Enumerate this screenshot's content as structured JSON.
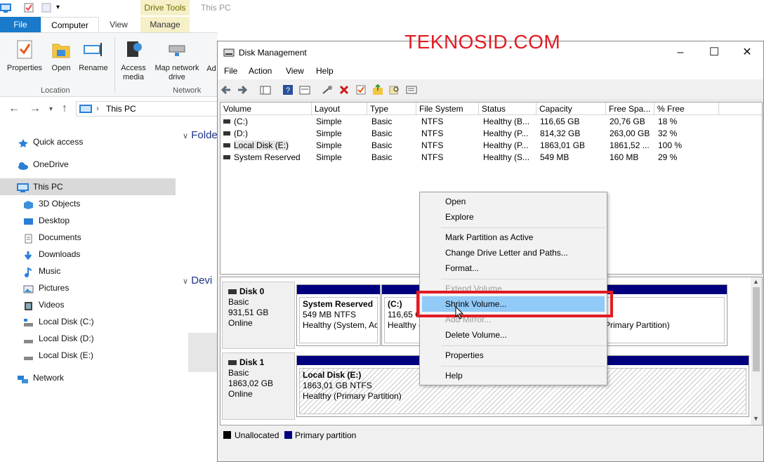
{
  "explorer": {
    "title": "This PC",
    "context_tab": "Drive Tools",
    "tabs": [
      "File",
      "Computer",
      "View",
      "Manage"
    ],
    "ribbon": {
      "buttons": [
        {
          "label": "Properties",
          "icon": "properties-icon"
        },
        {
          "label": "Open",
          "icon": "folder-open-icon"
        },
        {
          "label": "Rename",
          "icon": "rename-icon"
        },
        {
          "label": "Access media",
          "icon": "media-icon"
        },
        {
          "label": "Map network drive",
          "icon": "network-drive-icon"
        },
        {
          "label": "Ad",
          "icon": "add-icon"
        }
      ],
      "groups": [
        "Location",
        "Network"
      ]
    },
    "address": {
      "path": "This PC"
    },
    "nav": [
      {
        "label": "Quick access",
        "icon": "star-icon"
      },
      {
        "label": "OneDrive",
        "icon": "cloud-icon"
      },
      {
        "label": "This PC",
        "icon": "computer-icon",
        "selected": true
      },
      {
        "label": "3D Objects",
        "icon": "cube-icon"
      },
      {
        "label": "Desktop",
        "icon": "desktop-icon"
      },
      {
        "label": "Documents",
        "icon": "document-icon"
      },
      {
        "label": "Downloads",
        "icon": "download-icon"
      },
      {
        "label": "Music",
        "icon": "music-icon"
      },
      {
        "label": "Pictures",
        "icon": "picture-icon"
      },
      {
        "label": "Videos",
        "icon": "video-icon"
      },
      {
        "label": "Local Disk (C:)",
        "icon": "drive-icon"
      },
      {
        "label": "Local Disk (D:)",
        "icon": "drive-icon"
      },
      {
        "label": "Local Disk (E:)",
        "icon": "drive-icon"
      },
      {
        "label": "Network",
        "icon": "network-icon"
      }
    ],
    "groups": [
      "Folde",
      "Devi"
    ]
  },
  "watermark": "TEKNOSID.COM",
  "disk_management": {
    "title": "Disk Management",
    "menu": [
      "File",
      "Action",
      "View",
      "Help"
    ],
    "columns": [
      "Volume",
      "Layout",
      "Type",
      "File System",
      "Status",
      "Capacity",
      "Free Spa...",
      "% Free"
    ],
    "volumes": [
      [
        "(C:)",
        "Simple",
        "Basic",
        "NTFS",
        "Healthy (B...",
        "116,65 GB",
        "20,76 GB",
        "18 %"
      ],
      [
        "(D:)",
        "Simple",
        "Basic",
        "NTFS",
        "Healthy (P...",
        "814,32 GB",
        "263,00 GB",
        "32 %"
      ],
      [
        "Local Disk (E:)",
        "Simple",
        "Basic",
        "NTFS",
        "Healthy (P...",
        "1863,01 GB",
        "1861,52 ...",
        "100 %"
      ],
      [
        "System Reserved",
        "Simple",
        "Basic",
        "NTFS",
        "Healthy (S...",
        "549 MB",
        "160 MB",
        "29 %"
      ]
    ],
    "disks": [
      {
        "name": "Disk 0",
        "type": "Basic",
        "size": "931,51 GB",
        "state": "Online",
        "partitions": [
          {
            "name": "System Reserved",
            "size": "549 MB NTFS",
            "status": "Healthy (System, Ac"
          },
          {
            "name": "(C:)",
            "size": "116,65 G",
            "status": "Healthy ("
          },
          {
            "name": "",
            "size": "",
            "status": "le, Primary Partition)"
          }
        ]
      },
      {
        "name": "Disk 1",
        "type": "Basic",
        "size": "1863,02 GB",
        "state": "Online",
        "partitions": [
          {
            "name": "Local Disk  (E:)",
            "size": "1863,01 GB NTFS",
            "status": "Healthy (Primary Partition)"
          }
        ]
      }
    ],
    "legend": [
      {
        "label": "Unallocated",
        "color": "#000000"
      },
      {
        "label": "Primary partition",
        "color": "#00007f"
      }
    ]
  },
  "context_menu": {
    "items": [
      {
        "label": "Open",
        "enabled": true
      },
      {
        "label": "Explore",
        "enabled": true
      },
      {
        "label": "Mark Partition as Active",
        "enabled": true
      },
      {
        "label": "Change Drive Letter and Paths...",
        "enabled": true
      },
      {
        "label": "Format...",
        "enabled": true
      },
      {
        "label": "Extend Volume...",
        "enabled": false
      },
      {
        "label": "Shrink Volume...",
        "enabled": true,
        "highlighted": true
      },
      {
        "label": "Add Mirror...",
        "enabled": false
      },
      {
        "label": "Delete Volume...",
        "enabled": true
      },
      {
        "label": "Properties",
        "enabled": true
      },
      {
        "label": "Help",
        "enabled": true
      }
    ]
  },
  "colors": {
    "accent": "#1979ca",
    "highlight": "#91c9f7",
    "callout": "#e31b23",
    "partition": "#00007f"
  }
}
